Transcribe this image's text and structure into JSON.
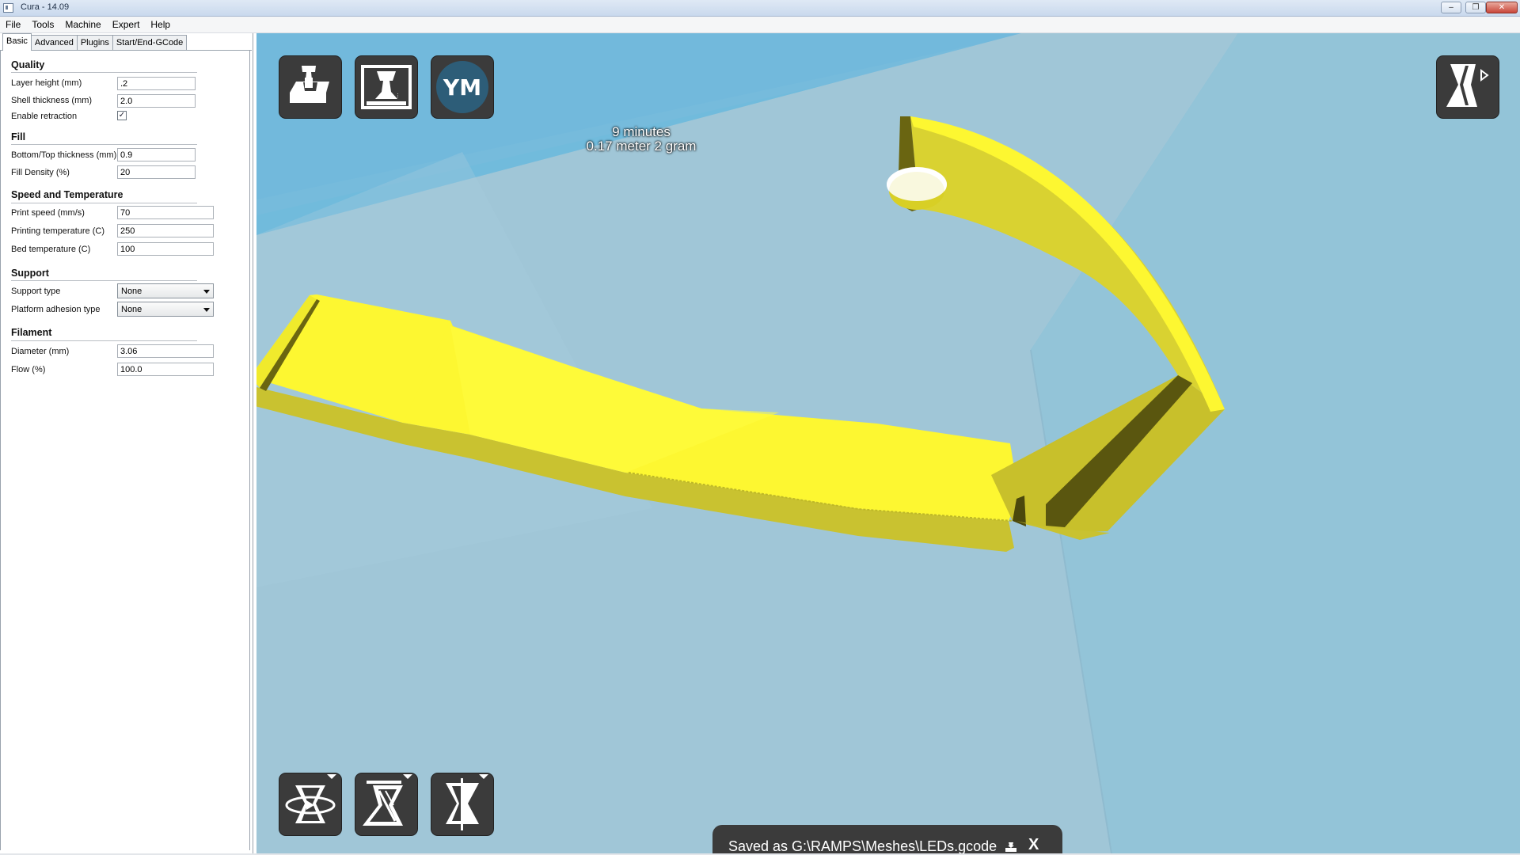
{
  "window": {
    "title": "Cura - 14.09"
  },
  "menu": [
    "File",
    "Tools",
    "Machine",
    "Expert",
    "Help"
  ],
  "tabs": [
    "Basic",
    "Advanced",
    "Plugins",
    "Start/End-GCode"
  ],
  "sections": {
    "quality": {
      "title": "Quality",
      "layer_height": {
        "label": "Layer height (mm)",
        "value": ".2"
      },
      "shell_thickness": {
        "label": "Shell thickness (mm)",
        "value": "2.0"
      },
      "enable_retraction": {
        "label": "Enable retraction",
        "checked": true,
        "mark": "✓"
      }
    },
    "fill": {
      "title": "Fill",
      "bottom_top_thickness": {
        "label": "Bottom/Top thickness (mm)",
        "value": "0.9"
      },
      "fill_density": {
        "label": "Fill Density (%)",
        "value": "20"
      }
    },
    "speed": {
      "title": "Speed and Temperature",
      "print_speed": {
        "label": "Print speed (mm/s)",
        "value": "70"
      },
      "print_temp": {
        "label": "Printing temperature (C)",
        "value": "250"
      },
      "bed_temp": {
        "label": "Bed temperature (C)",
        "value": "100"
      }
    },
    "support": {
      "title": "Support",
      "support_type": {
        "label": "Support type",
        "value": "None"
      },
      "adhesion_type": {
        "label": "Platform adhesion type",
        "value": "None"
      }
    },
    "filament": {
      "title": "Filament",
      "diameter": {
        "label": "Diameter (mm)",
        "value": "3.06"
      },
      "flow": {
        "label": "Flow (%)",
        "value": "100.0"
      }
    }
  },
  "viewport": {
    "load_icon": "load-model-icon",
    "print_icon": "print-icon",
    "youmagine_label": "YM",
    "view_mode_icon": "view-mode-icon",
    "rotate_icon": "rotate-icon",
    "scale_icon": "scale-icon",
    "mirror_icon": "mirror-icon",
    "print_time": "9 minutes",
    "print_material": "0.17 meter 2 gram",
    "status_message": "Saved as G:\\RAMPS\\Meshes\\LEDs.gcode",
    "status_close": "X"
  },
  "colors": {
    "model_yellow": "#ffff2a",
    "sky_blue": "#72b9dc",
    "platform_grey": "#a4c7d6",
    "button_dark": "#3b3b3b",
    "youmagine_blue": "#2d5d78"
  }
}
